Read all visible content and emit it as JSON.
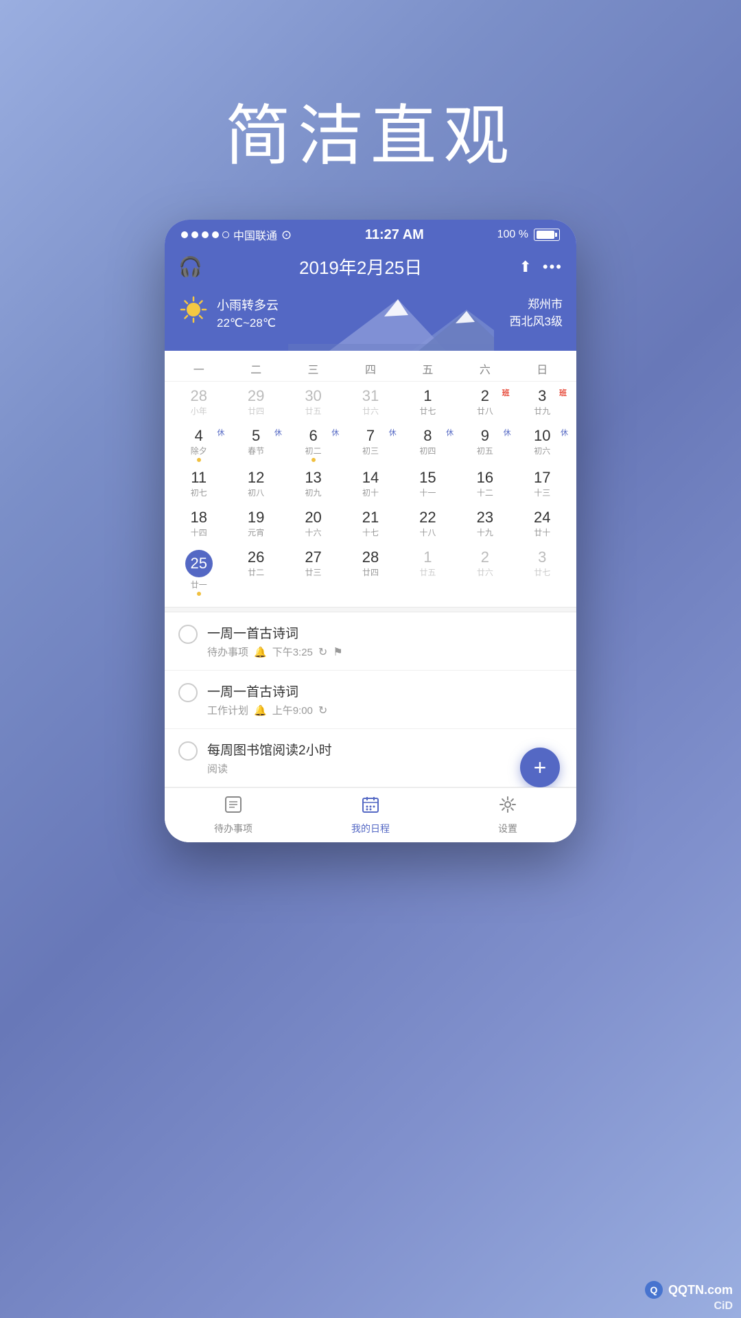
{
  "hero": {
    "title": "简洁直观"
  },
  "statusbar": {
    "dots": [
      "filled",
      "filled",
      "filled",
      "filled",
      "empty"
    ],
    "carrier": "中国联通",
    "wifi": "WiFi",
    "time": "11:27 AM",
    "battery": "100 %"
  },
  "header": {
    "icon_left": "headset",
    "date": "2019年2月25日",
    "actions": [
      "share",
      "more"
    ]
  },
  "weather": {
    "icon": "☀️",
    "description": "小雨转多云",
    "temp": "22℃~28℃",
    "city": "郑州市",
    "wind": "西北风3级"
  },
  "calendar": {
    "day_headers": [
      "一",
      "二",
      "三",
      "四",
      "五",
      "六",
      "日"
    ],
    "weeks": [
      [
        {
          "main": "28",
          "sub": "小年",
          "gray": true
        },
        {
          "main": "29",
          "sub": "廿四",
          "gray": true
        },
        {
          "main": "30",
          "sub": "廿五",
          "gray": true
        },
        {
          "main": "31",
          "sub": "廿六",
          "gray": true
        },
        {
          "main": "1",
          "sub": "廿七"
        },
        {
          "main": "2",
          "sub": "廿八",
          "badge": "班",
          "badge_color": "red"
        },
        {
          "main": "3",
          "sub": "廿九",
          "badge": "班",
          "badge_color": "red"
        }
      ],
      [
        {
          "main": "4",
          "sub": "除夕",
          "holiday": "休",
          "holiday_color": "blue",
          "dot": true
        },
        {
          "main": "5",
          "sub": "春节",
          "holiday": "休",
          "holiday_color": "blue"
        },
        {
          "main": "6",
          "sub": "初二",
          "holiday": "休",
          "holiday_color": "blue",
          "dot": true
        },
        {
          "main": "7",
          "sub": "初三",
          "holiday": "休",
          "holiday_color": "blue"
        },
        {
          "main": "8",
          "sub": "初四",
          "holiday": "休",
          "holiday_color": "blue"
        },
        {
          "main": "9",
          "sub": "初五",
          "holiday": "休",
          "holiday_color": "blue"
        },
        {
          "main": "10",
          "sub": "初六",
          "holiday": "休",
          "holiday_color": "blue"
        }
      ],
      [
        {
          "main": "11",
          "sub": "初七"
        },
        {
          "main": "12",
          "sub": "初八"
        },
        {
          "main": "13",
          "sub": "初九"
        },
        {
          "main": "14",
          "sub": "初十"
        },
        {
          "main": "15",
          "sub": "十一"
        },
        {
          "main": "16",
          "sub": "十二"
        },
        {
          "main": "17",
          "sub": "十三"
        }
      ],
      [
        {
          "main": "18",
          "sub": "十四"
        },
        {
          "main": "19",
          "sub": "元宵"
        },
        {
          "main": "20",
          "sub": "十六"
        },
        {
          "main": "21",
          "sub": "十七"
        },
        {
          "main": "22",
          "sub": "十八"
        },
        {
          "main": "23",
          "sub": "十九"
        },
        {
          "main": "24",
          "sub": "廿十"
        }
      ],
      [
        {
          "main": "25",
          "sub": "廿一",
          "today": true,
          "dot": true
        },
        {
          "main": "26",
          "sub": "廿二"
        },
        {
          "main": "27",
          "sub": "廿三"
        },
        {
          "main": "28",
          "sub": "廿四"
        },
        {
          "main": "1",
          "sub": "廿五",
          "gray": true
        },
        {
          "main": "2",
          "sub": "廿六",
          "gray": true
        },
        {
          "main": "3",
          "sub": "廿七",
          "gray": true
        }
      ]
    ]
  },
  "tasks": [
    {
      "title": "一周一首古诗词",
      "category": "待办事项",
      "bell": "🔔",
      "time": "下午3:25",
      "repeat": "↻",
      "flag": "🏳"
    },
    {
      "title": "一周一首古诗词",
      "category": "工作计划",
      "bell": "🔔",
      "time": "上午9:00",
      "repeat": "↻"
    },
    {
      "title": "每周图书馆阅读2小时",
      "category": "阅读"
    }
  ],
  "nav": [
    {
      "icon": "📋",
      "label": "待办事项",
      "active": false
    },
    {
      "icon": "📅",
      "label": "我的日程",
      "active": true
    },
    {
      "icon": "⚙️",
      "label": "设置",
      "active": false
    }
  ],
  "fab": {
    "label": "+"
  },
  "watermark": {
    "brand": "CiD",
    "site": "QQTN.com"
  }
}
